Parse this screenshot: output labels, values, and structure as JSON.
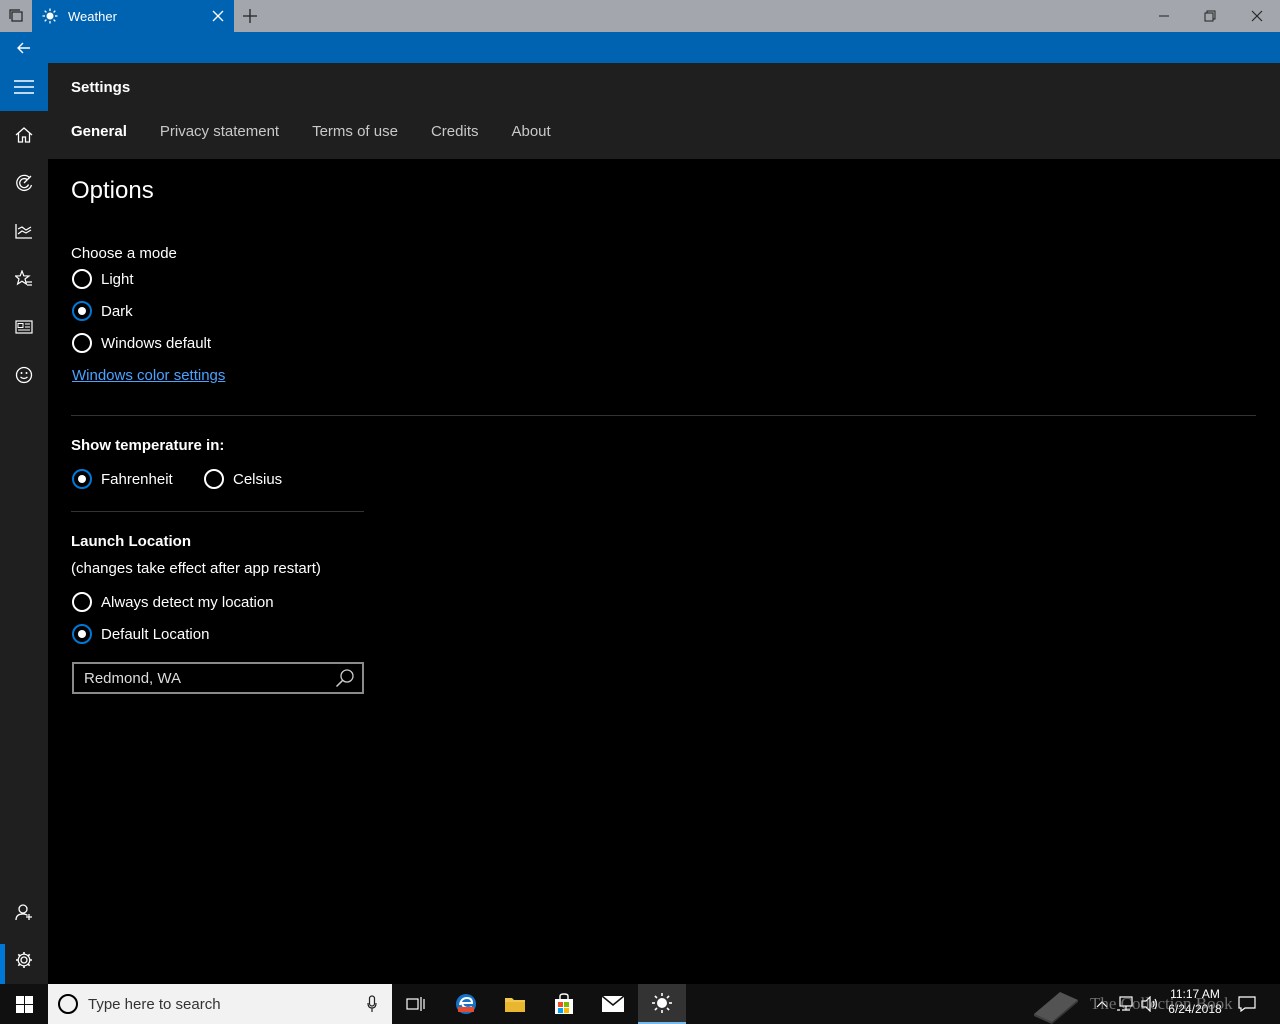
{
  "window": {
    "tab_title": "Weather",
    "colors": {
      "accent": "#0063b1",
      "titlebar": "#a3a6ad",
      "link": "#4aa3ff"
    }
  },
  "nav": {
    "items": [
      "hamburger-icon",
      "home-icon",
      "radar-icon",
      "historical-weather-icon",
      "favorites-icon",
      "news-icon",
      "feedback-icon"
    ],
    "bottom": [
      "account-icon",
      "settings-icon"
    ]
  },
  "header": {
    "title": "Settings",
    "tabs": [
      {
        "label": "General",
        "active": true
      },
      {
        "label": "Privacy statement",
        "active": false
      },
      {
        "label": "Terms of use",
        "active": false
      },
      {
        "label": "Credits",
        "active": false
      },
      {
        "label": "About",
        "active": false
      }
    ]
  },
  "options": {
    "title": "Options",
    "mode_label": "Choose a mode",
    "modes": [
      {
        "label": "Light",
        "selected": false
      },
      {
        "label": "Dark",
        "selected": true
      },
      {
        "label": "Windows default",
        "selected": false
      }
    ],
    "color_link": "Windows color settings",
    "temp_label": "Show temperature in:",
    "temps": [
      {
        "label": "Fahrenheit",
        "selected": true
      },
      {
        "label": "Celsius",
        "selected": false
      }
    ],
    "launch_label": "Launch Location",
    "launch_note": "(changes take effect after app restart)",
    "launch_options": [
      {
        "label": "Always detect my location",
        "selected": false
      },
      {
        "label": "Default Location",
        "selected": true
      }
    ],
    "location_value": "Redmond, WA"
  },
  "taskbar": {
    "search_placeholder": "Type here to search",
    "apps": [
      "task-view-icon",
      "edge-beta-icon",
      "file-explorer-icon",
      "store-icon",
      "mail-icon",
      "weather-icon"
    ],
    "time": "11:17 AM",
    "date": "6/24/2018"
  },
  "watermark": {
    "text": "The Collection Book"
  }
}
